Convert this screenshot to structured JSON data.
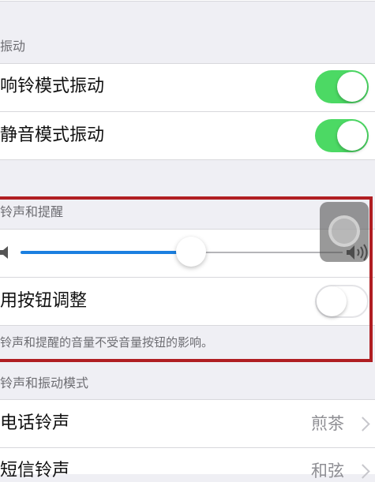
{
  "vibrate": {
    "header": "振动",
    "ring_label": "响铃模式振动",
    "ring_on": true,
    "silent_label": "静音模式振动",
    "silent_on": true
  },
  "ringer": {
    "header": "铃声和提醒",
    "volume_level": 0.53,
    "buttons_label": "用按钮调整",
    "buttons_on": false,
    "footer": "铃声和提醒的音量不受音量按钮的影响。"
  },
  "sounds": {
    "header": "铃声和振动模式",
    "items": [
      {
        "label": "电话铃声",
        "value": "煎茶"
      },
      {
        "label": "短信铃声",
        "value": "和弦"
      }
    ]
  },
  "colors": {
    "toggle_on": "#4cd964",
    "slider_fill": "#1b7fe0",
    "highlight_box": "#b01e22"
  }
}
